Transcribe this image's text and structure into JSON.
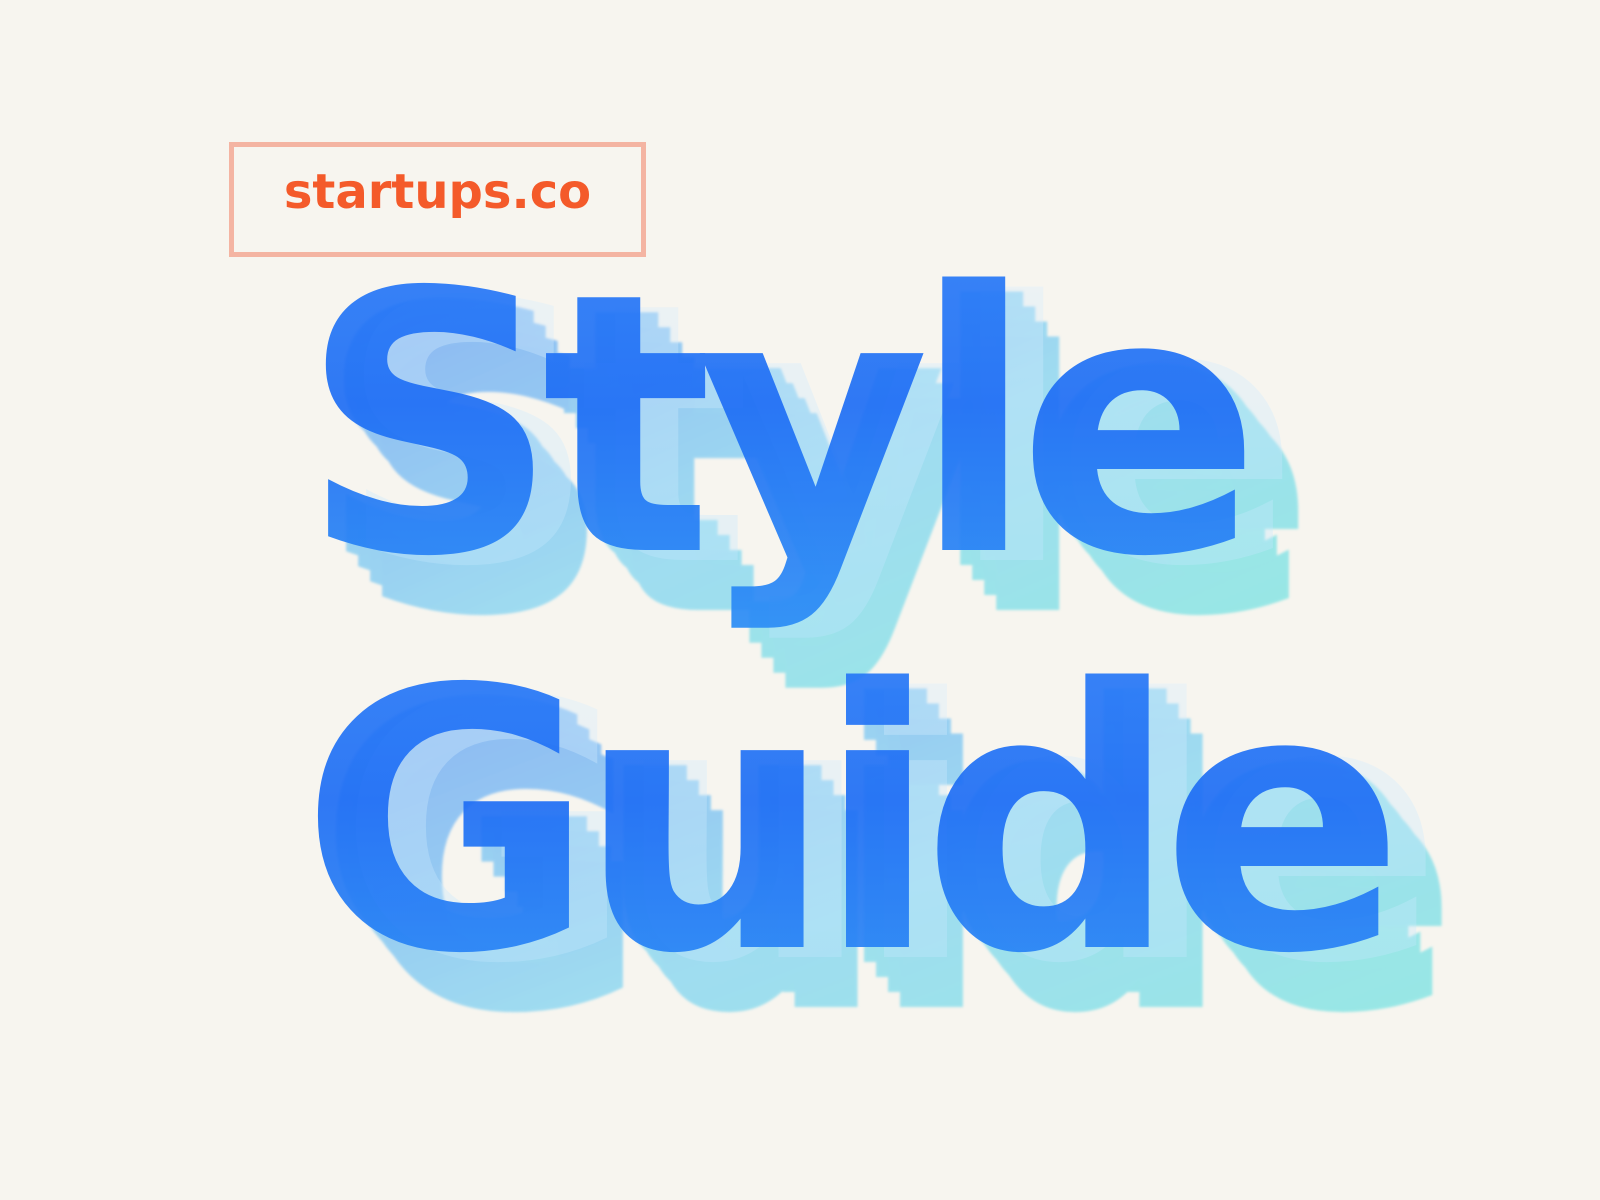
{
  "logo": {
    "text": "startups.co"
  },
  "headline": {
    "line1": "Style",
    "line2": "Guide"
  },
  "colors": {
    "background": "#f7f5ef",
    "logo_text": "#f45a2a",
    "logo_border": "#f4b4a2",
    "text_blue": "#1f6ef5",
    "text_cyan": "#4fe6dc",
    "text_light": "#d8ecff"
  }
}
